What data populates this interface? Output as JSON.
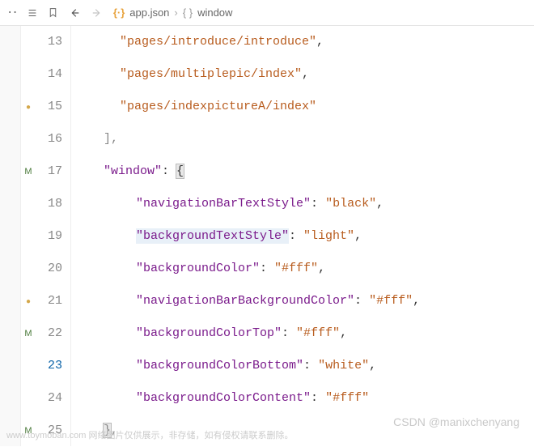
{
  "breadcrumb": {
    "file": "app.json",
    "section": "window"
  },
  "gutter": [
    {
      "ln": 13,
      "mark": ""
    },
    {
      "ln": 14,
      "mark": ""
    },
    {
      "ln": 15,
      "mark": "dot"
    },
    {
      "ln": 16,
      "mark": ""
    },
    {
      "ln": 17,
      "mark": "M",
      "fold": true
    },
    {
      "ln": 18,
      "mark": ""
    },
    {
      "ln": 19,
      "mark": ""
    },
    {
      "ln": 20,
      "mark": ""
    },
    {
      "ln": 21,
      "mark": "dot"
    },
    {
      "ln": 22,
      "mark": "M"
    },
    {
      "ln": 23,
      "mark": "",
      "current": true
    },
    {
      "ln": 24,
      "mark": ""
    },
    {
      "ln": 25,
      "mark": "M"
    }
  ],
  "code": {
    "l13": "\"pages/introduce/introduce\"",
    "l14": "\"pages/multiplepic/index\"",
    "l15": "\"pages/indexpictureA/index\"",
    "l16": "],",
    "l17_key": "\"window\"",
    "l17_brace": "{",
    "l18_k": "\"navigationBarTextStyle\"",
    "l18_v": "\"black\"",
    "l19_k": "\"backgroundTextStyle\"",
    "l19_v": "\"light\"",
    "l20_k": "\"backgroundColor\"",
    "l20_v": "\"#fff\"",
    "l21_k": "\"navigationBarBackgroundColor\"",
    "l21_v": "\"#fff\"",
    "l22_k": "\"backgroundColorTop\"",
    "l22_v": "\"#fff\"",
    "l23_k": "\"backgroundColorBottom\"",
    "l23_v": "\"white\"",
    "l24_k": "\"backgroundColorContent\"",
    "l24_v": "\"#fff\"",
    "l25": "},"
  },
  "watermarks": {
    "w1": "www.toymoban.com 网络图片仅供展示，非存储，如有侵权请联系删除。",
    "w2": "CSDN @manixchenyang"
  }
}
